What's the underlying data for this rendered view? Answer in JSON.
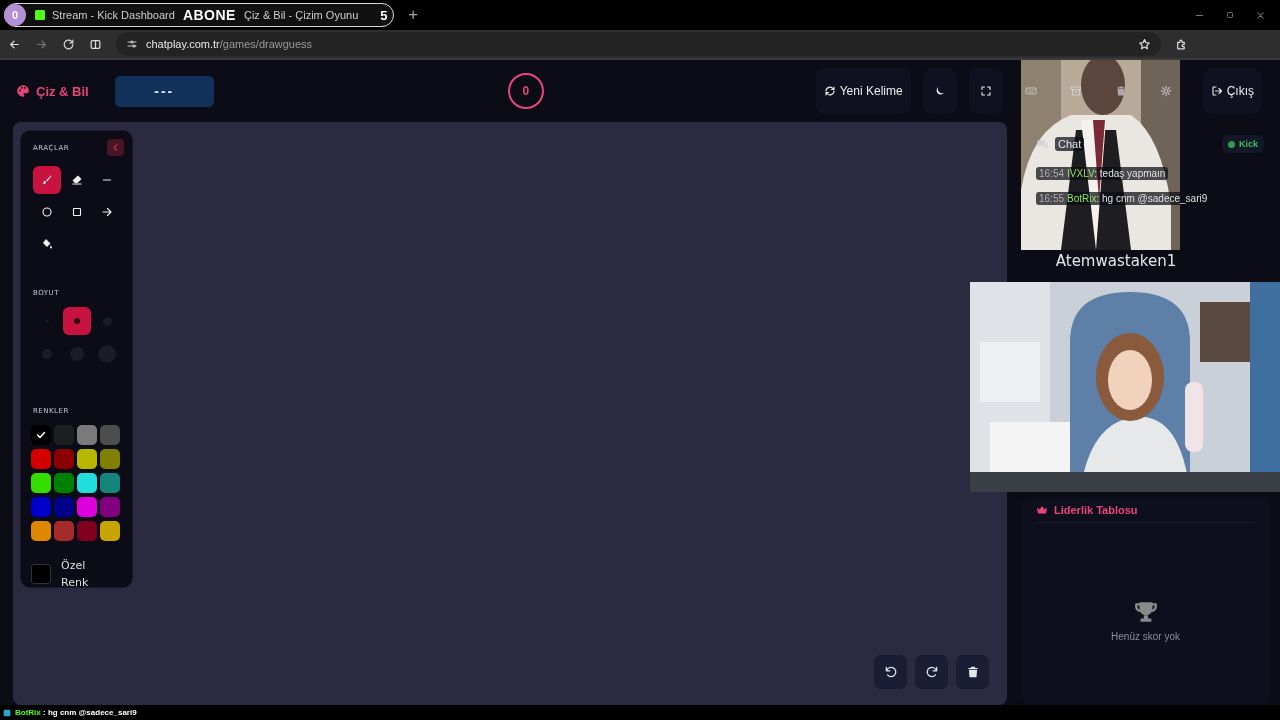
{
  "browser": {
    "group_badge": "0",
    "tabs": [
      {
        "title": "Stream - Kick Dashboard"
      },
      {
        "title": "Çiz & Bil - Çizim Oyunu"
      }
    ],
    "tab_overlay": "ABONE",
    "tab_count": "5",
    "new_tab": "+",
    "url_host": "chatplay.com.tr",
    "url_path": "/games/drawguess"
  },
  "header": {
    "logo": "Çiz & Bil",
    "word": "---",
    "timer": "0",
    "buttons": [
      {
        "kind": "new_word",
        "label": "Yeni Kelime"
      },
      {
        "kind": "theme"
      },
      {
        "kind": "fullscreen"
      },
      {
        "kind": "keyboard"
      },
      {
        "kind": "archive"
      },
      {
        "kind": "trash"
      },
      {
        "kind": "settings"
      },
      {
        "kind": "logout",
        "label": "Çıkış"
      }
    ]
  },
  "tools": {
    "title": "ARAÇLAR",
    "items": [
      {
        "kind": "brush",
        "selected": true
      },
      {
        "kind": "eraser",
        "selected": false
      },
      {
        "kind": "line",
        "selected": false
      },
      {
        "kind": "circle",
        "selected": false
      },
      {
        "kind": "rectangle",
        "selected": false
      },
      {
        "kind": "arrow",
        "selected": false
      },
      {
        "kind": "fill",
        "selected": false
      }
    ],
    "size_title": "BOYUT",
    "sizes": [
      {
        "selected": false
      },
      {
        "selected": true
      },
      {
        "selected": false
      },
      {
        "selected": false
      },
      {
        "selected": false
      },
      {
        "selected": false
      }
    ],
    "colors_title": "RENKLER",
    "colors": [
      {
        "color": "#000000",
        "selected": true
      },
      {
        "color": "#1c1f1f",
        "selected": false
      },
      {
        "color": "#7a7a7a",
        "selected": false
      },
      {
        "color": "#4d4d4d",
        "selected": false
      },
      {
        "color": "#d40000",
        "selected": false
      },
      {
        "color": "#8b0000",
        "selected": false
      },
      {
        "color": "#b8b800",
        "selected": false
      },
      {
        "color": "#808000",
        "selected": false
      },
      {
        "color": "#33dd00",
        "selected": false
      },
      {
        "color": "#008000",
        "selected": false
      },
      {
        "color": "#22dddd",
        "selected": false
      },
      {
        "color": "#14857a",
        "selected": false
      },
      {
        "color": "#0000cc",
        "selected": false
      },
      {
        "color": "#00008b",
        "selected": false
      },
      {
        "color": "#dd00dd",
        "selected": false
      },
      {
        "color": "#800080",
        "selected": false
      },
      {
        "color": "#dd8800",
        "selected": false
      },
      {
        "color": "#a52a2a",
        "selected": false
      },
      {
        "color": "#800020",
        "selected": false
      },
      {
        "color": "#c8a400",
        "selected": false
      }
    ],
    "custom_label": "Özel Renk"
  },
  "canvas": {
    "actions": [
      {
        "kind": "undo"
      },
      {
        "kind": "redo"
      },
      {
        "kind": "clear"
      }
    ]
  },
  "chat": {
    "title": "Chat",
    "platform": "Kick",
    "messages": [
      {
        "time": "16:54",
        "user": "IVXLV",
        "text": ": tedaş yapmaın"
      },
      {
        "time": "16:55",
        "user": "BotRix",
        "text": ": hg cnm @sadece_sari9"
      }
    ]
  },
  "streamer_name": "Atemwastaken1",
  "leaderboard": {
    "title": "Liderlik Tablosu",
    "empty_text": "Henüz skor yok"
  },
  "ticker": {
    "user": "BotRix",
    "text": " : hg cnm @sadece_sari9"
  }
}
